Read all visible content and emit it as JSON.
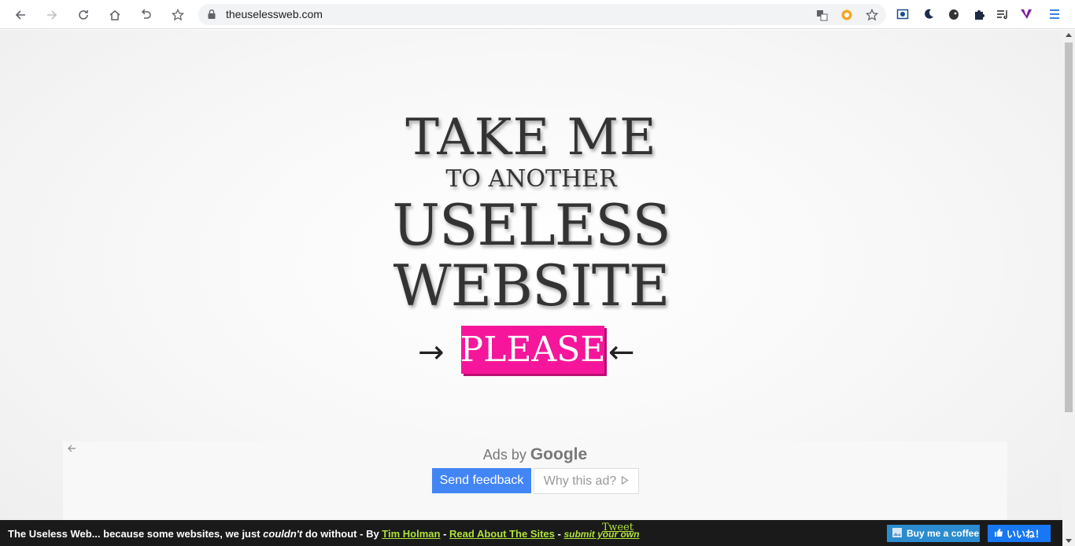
{
  "browser": {
    "url": "theuselessweb.com",
    "colors": {
      "accent": "#1a73e8",
      "toolbar": "#ffffff"
    },
    "nav_icons": [
      "back-icon",
      "forward-icon",
      "reload-icon",
      "home-icon",
      "undo-icon",
      "bookmark-star-icon"
    ],
    "extension_icons": [
      "translate-icon",
      "honey-extension-icon",
      "bookmark-star-icon",
      "screen-capture-icon",
      "dark-mode-icon",
      "evernote-icon",
      "extensions-puzzle-icon",
      "reading-list-icon",
      "vivaldi-v-icon",
      "menu-icon"
    ]
  },
  "hero": {
    "line1": "TAKE ME",
    "line2": "TO ANOTHER",
    "line3": "USELESS",
    "line4": "WEBSITE",
    "button": "PLEASE",
    "arrow_right": "→",
    "arrow_left": "←",
    "button_color": "#f6169b"
  },
  "ad": {
    "ads_by": "Ads by",
    "google": "Google",
    "send_feedback": "Send feedback",
    "why_this_ad": "Why this ad?"
  },
  "footer": {
    "prefix": "The Useless Web... because some websites, we just ",
    "emphasis": "couldn't",
    "middle": " do without - By ",
    "author_link": "Tim Holman",
    "sep1": " - ",
    "read_link": "Read About The Sites",
    "sep2": " - ",
    "submit_link": "submit your own",
    "tweet": "Tweet",
    "coffee": "Buy me a coffee",
    "like": "いいね！"
  }
}
